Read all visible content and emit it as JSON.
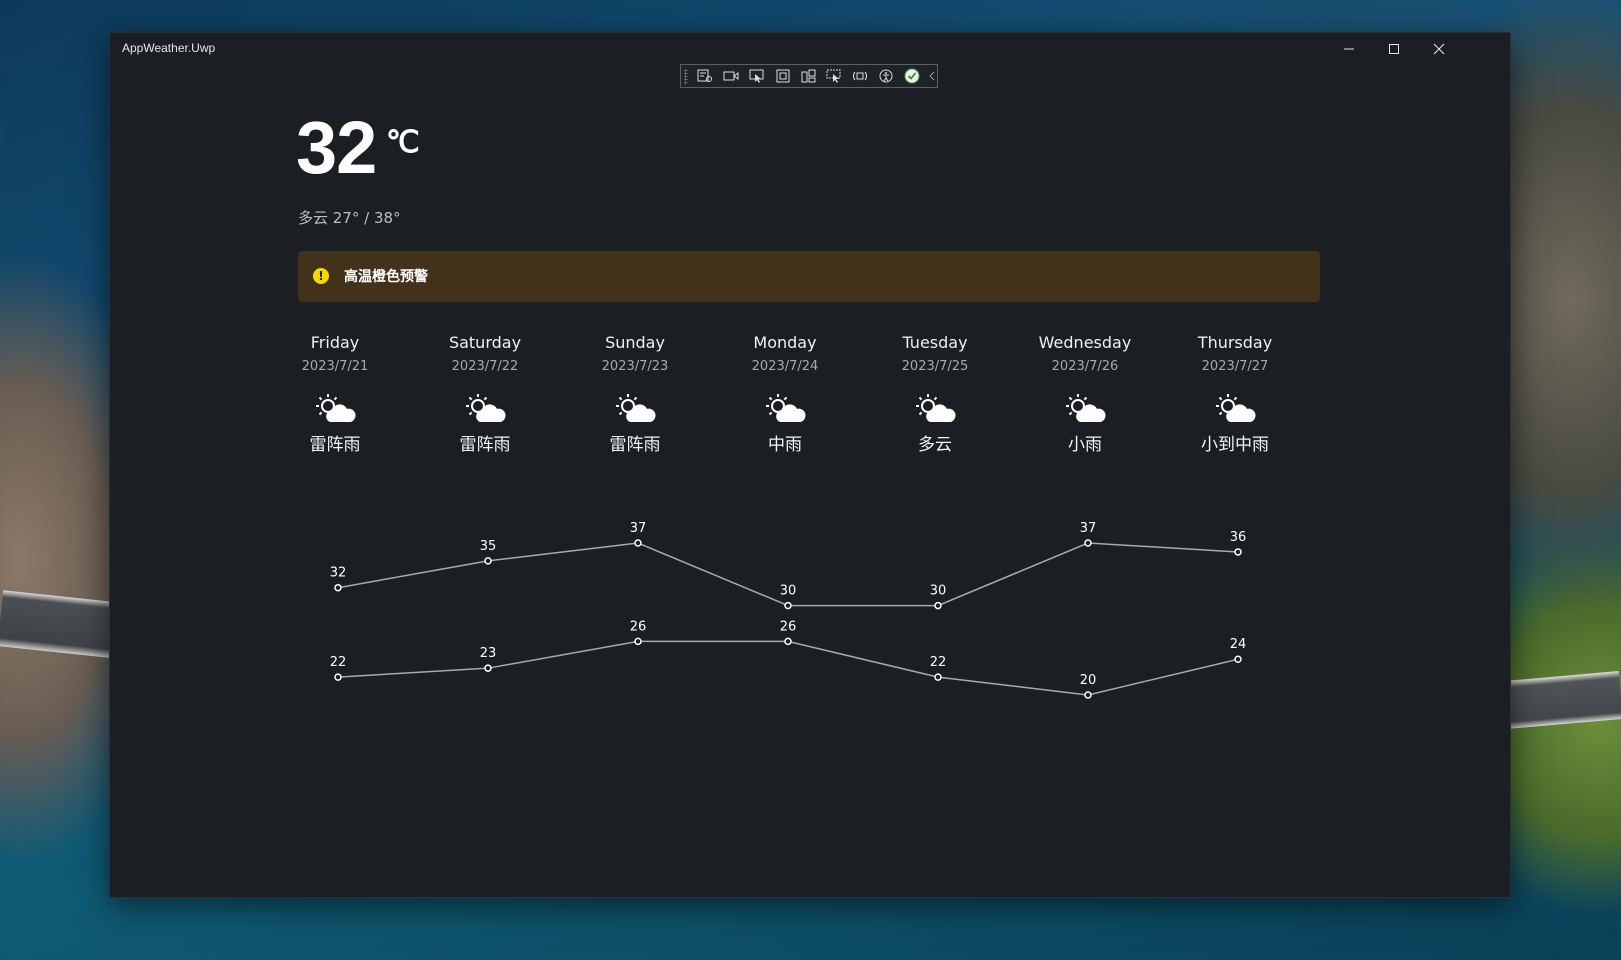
{
  "window": {
    "title": "AppWeather.Uwp"
  },
  "current": {
    "temperature": "32",
    "unit": "℃",
    "summary": "多云 27° / 38°"
  },
  "alert": {
    "text": "高温橙色预警",
    "icon": "warning-icon",
    "color": "#f5d800"
  },
  "debug_toolbar": {
    "icons": [
      "live-visual-tree-icon",
      "record-icon",
      "select-element-icon",
      "display-layout-adorners-icon",
      "track-focus-icon",
      "binding-failures-icon",
      "hot-reload-icon",
      "accessibility-icon",
      "check-icon",
      "collapse-chevron-icon"
    ]
  },
  "forecast": [
    {
      "day": "Friday",
      "date": "2023/7/21",
      "condition": "雷阵雨",
      "icon": "partly-cloudy-icon"
    },
    {
      "day": "Saturday",
      "date": "2023/7/22",
      "condition": "雷阵雨",
      "icon": "partly-cloudy-icon"
    },
    {
      "day": "Sunday",
      "date": "2023/7/23",
      "condition": "雷阵雨",
      "icon": "partly-cloudy-icon"
    },
    {
      "day": "Monday",
      "date": "2023/7/24",
      "condition": "中雨",
      "icon": "partly-cloudy-icon"
    },
    {
      "day": "Tuesday",
      "date": "2023/7/25",
      "condition": "多云",
      "icon": "partly-cloudy-icon"
    },
    {
      "day": "Wednesday",
      "date": "2023/7/26",
      "condition": "小雨",
      "icon": "partly-cloudy-icon"
    },
    {
      "day": "Thursday",
      "date": "2023/7/27",
      "condition": "小到中雨",
      "icon": "partly-cloudy-icon"
    }
  ],
  "chart_data": {
    "type": "line",
    "categories": [
      "2023/7/21",
      "2023/7/22",
      "2023/7/23",
      "2023/7/24",
      "2023/7/25",
      "2023/7/26",
      "2023/7/27"
    ],
    "series": [
      {
        "values": [
          32,
          35,
          37,
          30,
          30,
          37,
          36
        ]
      },
      {
        "values": [
          22,
          23,
          26,
          26,
          22,
          20,
          24
        ]
      }
    ],
    "ylim": [
      20,
      37
    ],
    "grid": false,
    "line_color": "#a9a9a9",
    "point_color": "#ffffff"
  }
}
